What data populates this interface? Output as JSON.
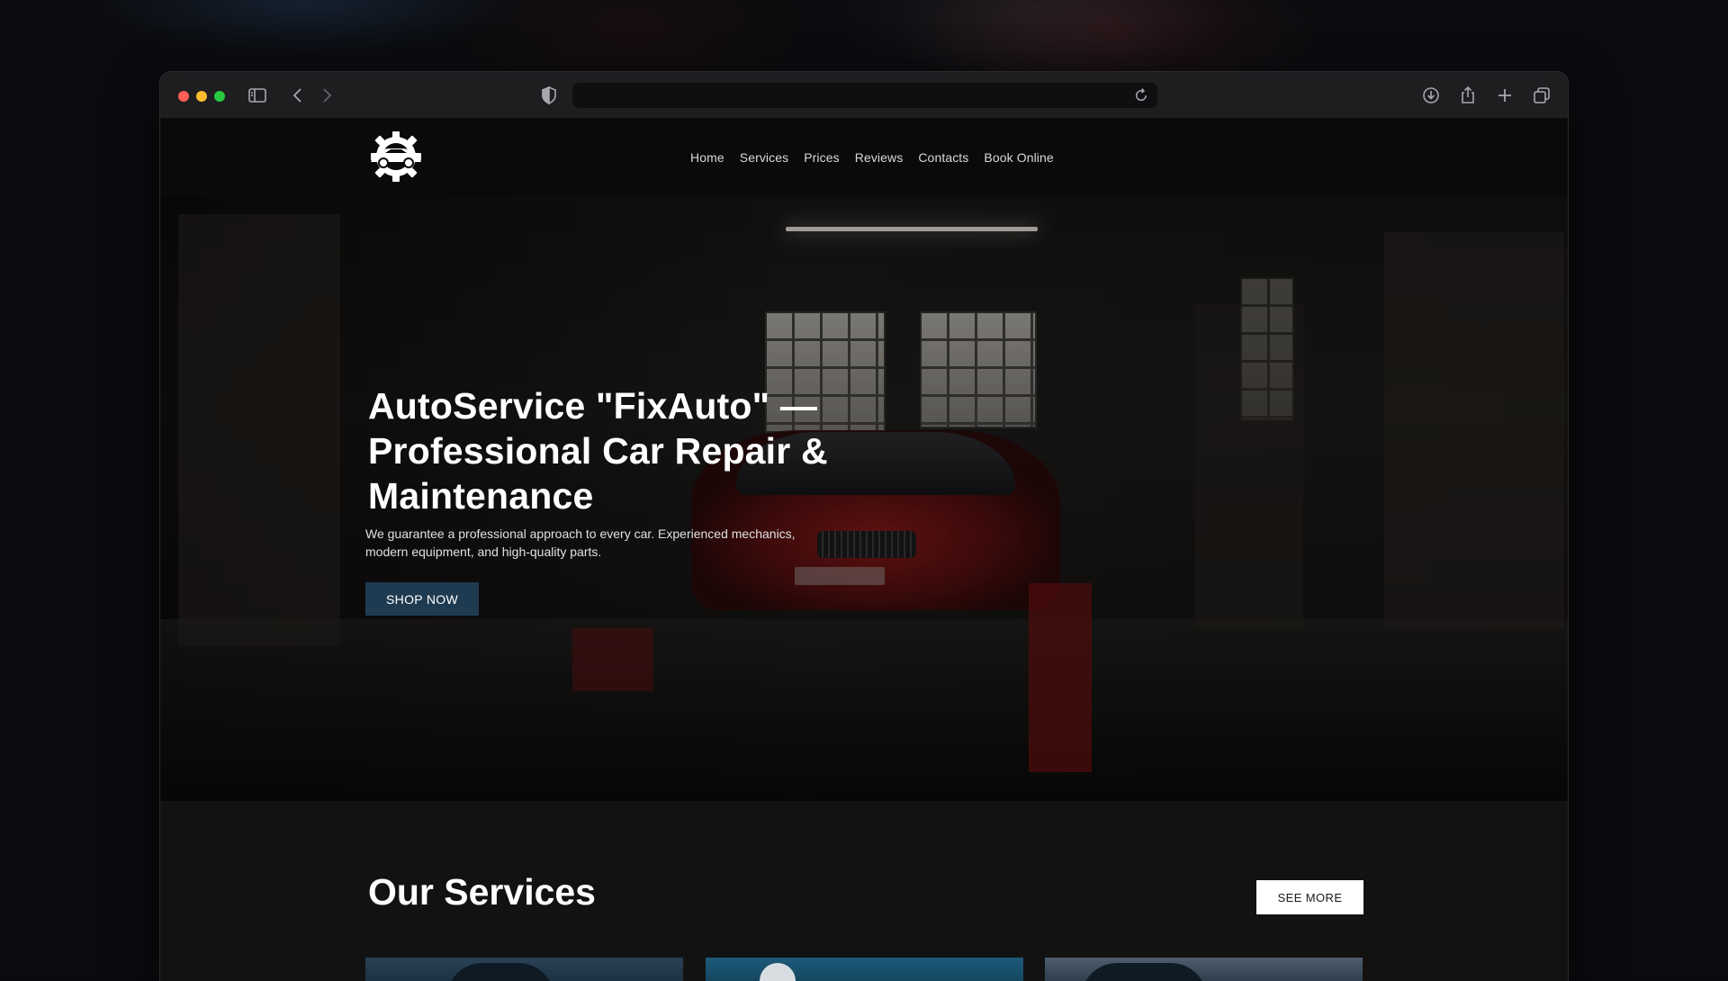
{
  "browser": {
    "url": "",
    "icons": [
      "sidebar-icon",
      "back-icon",
      "forward-icon",
      "privacy-shield-icon",
      "reload-icon",
      "download-icon",
      "share-icon",
      "new-tab-icon",
      "tabs-overview-icon"
    ]
  },
  "site": {
    "logo": "gear-car-logo",
    "nav": [
      "Home",
      "Services",
      "Prices",
      "Reviews",
      "Contacts",
      "Book Online"
    ],
    "hero": {
      "title": "AutoService \"FixAuto\" — Professional Car Repair & Maintenance",
      "description": "We guarantee a professional approach to every car. Experienced mechanics, modern equipment, and high-quality parts.",
      "cta": "SHOP NOW"
    },
    "services": {
      "title": "Our Services",
      "see_more": "SEE MORE"
    }
  },
  "colors": {
    "cta_button": "#1f3b52",
    "header_bg": "#0a0a0a",
    "page_bg": "#121212"
  }
}
